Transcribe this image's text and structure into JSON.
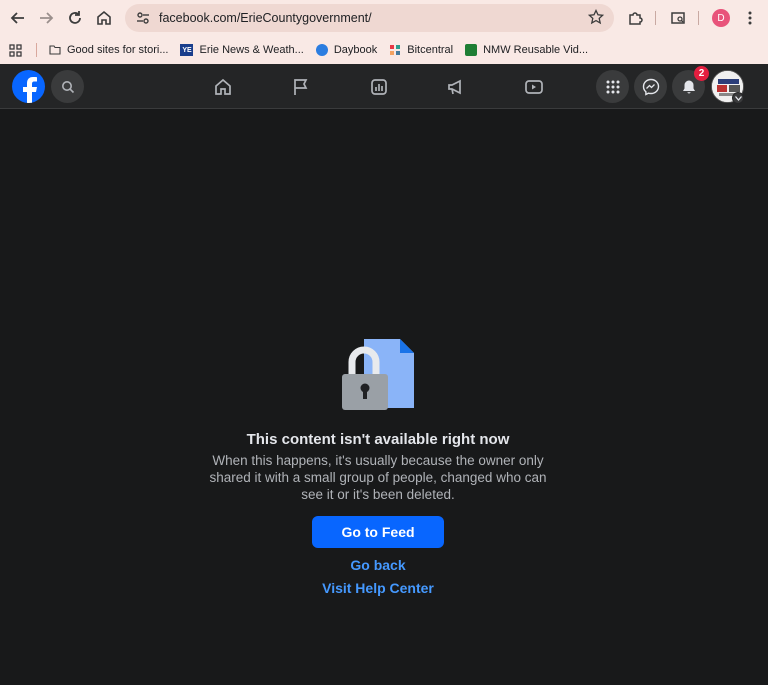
{
  "browser": {
    "url": "facebook.com/ErieCountygovernment/",
    "profile_initial": "D",
    "bookmarks": [
      {
        "label": "Good sites for stori...",
        "icon": "folder-icon"
      },
      {
        "label": "Erie News & Weath...",
        "icon": "yie-icon"
      },
      {
        "label": "Daybook",
        "icon": "globe-icon"
      },
      {
        "label": "Bitcentral",
        "icon": "bitcentral-icon"
      },
      {
        "label": "NMW Reusable Vid...",
        "icon": "excel-icon"
      }
    ]
  },
  "fb": {
    "notification_count": "2"
  },
  "message": {
    "title": "This content isn't available right now",
    "body": "When this happens, it's usually because the owner only shared it with a small group of people, changed who can see it or it's been deleted.",
    "primary_button": "Go to Feed",
    "link_back": "Go back",
    "link_help": "Visit Help Center"
  },
  "colors": {
    "accent": "#0866ff",
    "link": "#4599ff",
    "background": "#18191a",
    "header": "#242526",
    "badge": "#e41e3f"
  }
}
